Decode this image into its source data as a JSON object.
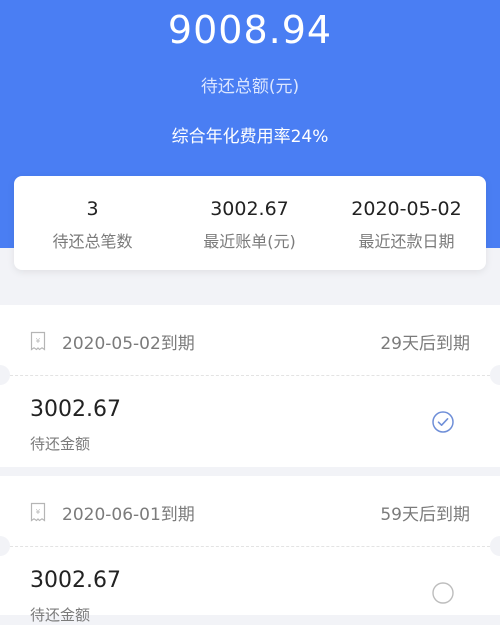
{
  "header": {
    "total_amount": "9008.94",
    "total_label": "待还总额(元)",
    "annual_rate_text": "综合年化费用率24%"
  },
  "summary": {
    "items": [
      {
        "value": "3",
        "label": "待还总笔数"
      },
      {
        "value": "3002.67",
        "label": "最近账单(元)"
      },
      {
        "value": "2020-05-02",
        "label": "最近还款日期"
      }
    ]
  },
  "bills": [
    {
      "due_date": "2020-05-02到期",
      "due_in": "29天后到期",
      "amount": "3002.67",
      "amount_label": "待还金额",
      "selected": true,
      "icon": "receipt-icon"
    },
    {
      "due_date": "2020-06-01到期",
      "due_in": "59天后到期",
      "amount": "3002.67",
      "amount_label": "待还金额",
      "selected": false,
      "icon": "receipt-icon"
    }
  ],
  "colors": {
    "accent": "#4a7ef3",
    "check": "#6f8fd8",
    "radio": "#bdbdbd"
  }
}
